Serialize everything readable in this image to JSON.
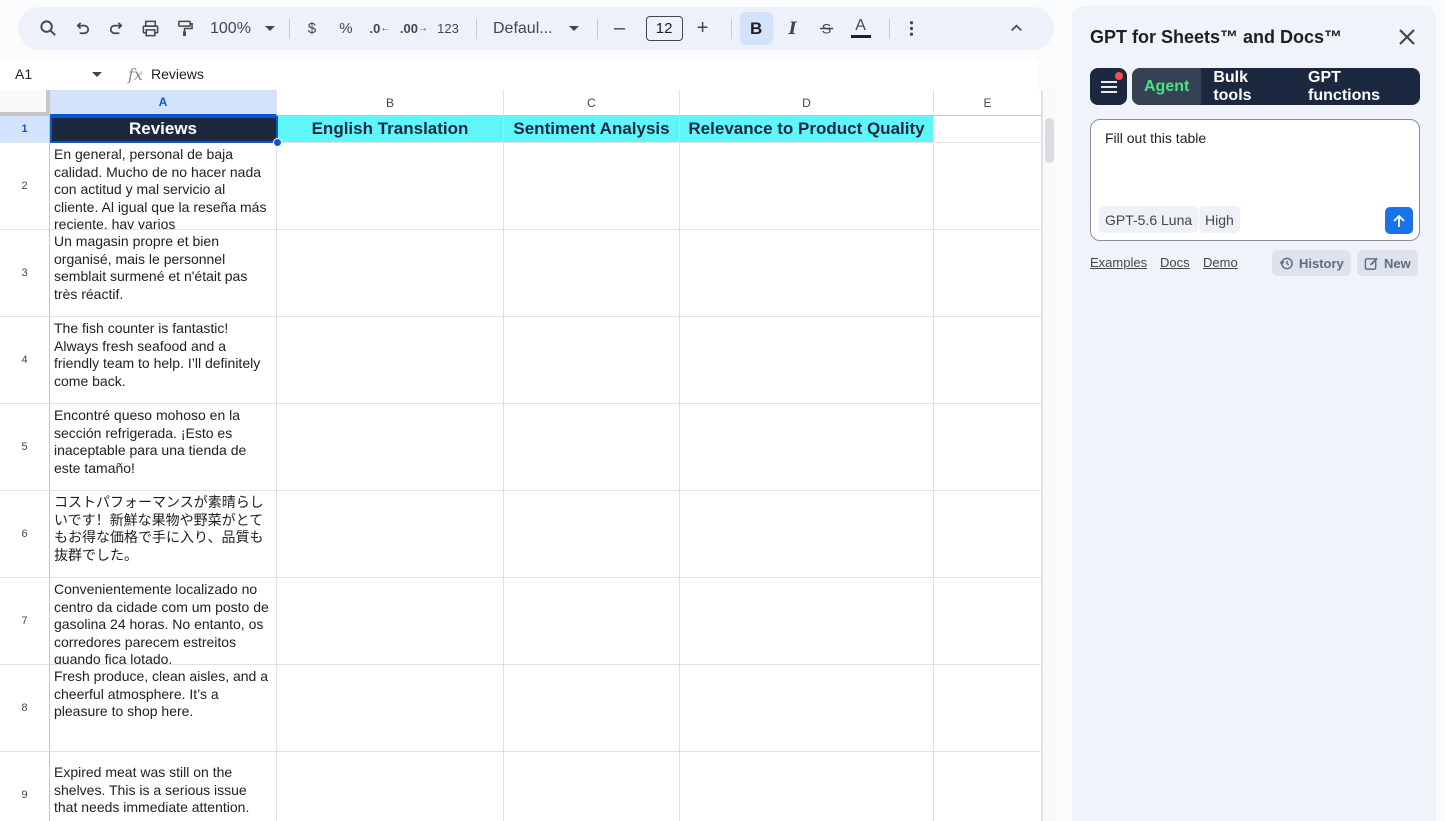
{
  "toolbar": {
    "zoom": "100%",
    "currency": "$",
    "percent": "%",
    "decrease_decimal": ".0",
    "increase_decimal": ".00",
    "number_format": "123",
    "font": "Defaul...",
    "font_size": "12",
    "minus": "–",
    "plus": "+",
    "bold": "B",
    "italic": "I",
    "text_color": "A"
  },
  "formula_bar": {
    "cell_ref": "A1",
    "fx": "fx",
    "content": "Reviews"
  },
  "grid": {
    "columns": [
      "A",
      "B",
      "C",
      "D",
      "E"
    ],
    "rows": [
      "1",
      "2",
      "3",
      "4",
      "5",
      "6",
      "7",
      "8",
      "9"
    ],
    "headers": {
      "a": "Reviews",
      "b": "English Translation",
      "c": "Sentiment Analysis",
      "d": "Relevance to Product Quality"
    },
    "reviews": [
      "En general, personal de baja calidad. Mucho de no hacer nada con actitud y mal servicio al cliente. Al igual que la reseña más reciente, hay varios",
      "Un magasin propre et bien organisé, mais le personnel semblait surmené et n'était pas très réactif.",
      "The fish counter is fantastic! Always fresh seafood and a friendly team to help. I’ll definitely come back.",
      "Encontré queso mohoso en la sección refrigerada. ¡Esto es inaceptable para una tienda de este tamaño!",
      "コストパフォーマンスが素晴らしいです！新鮮な果物や野菜がとてもお得な価格で手に入り、品質も抜群でした。",
      "Convenientemente localizado no centro da cidade com um posto de gasolina 24 horas. No entanto, os corredores parecem estreitos quando fica lotado.",
      "Fresh produce, clean aisles, and a cheerful atmosphere. It’s a pleasure to shop here.",
      "Expired meat was still on the shelves. This is a serious issue that needs immediate attention."
    ]
  },
  "sidebar": {
    "title": "GPT for Sheets™ and Docs™",
    "tabs": [
      "Agent",
      "Bulk tools",
      "GPT functions"
    ],
    "prompt": "Fill out this table",
    "model": "GPT-5.6 Luna",
    "effort": "High",
    "links": [
      "Examples",
      "Docs",
      "Demo"
    ],
    "history": "History",
    "new": "New"
  },
  "colors": {
    "header_dark": "#1c2840",
    "header_cyan": "#5ef6fa",
    "agent_green": "#4ee083",
    "accent_blue": "#0b57d0"
  }
}
